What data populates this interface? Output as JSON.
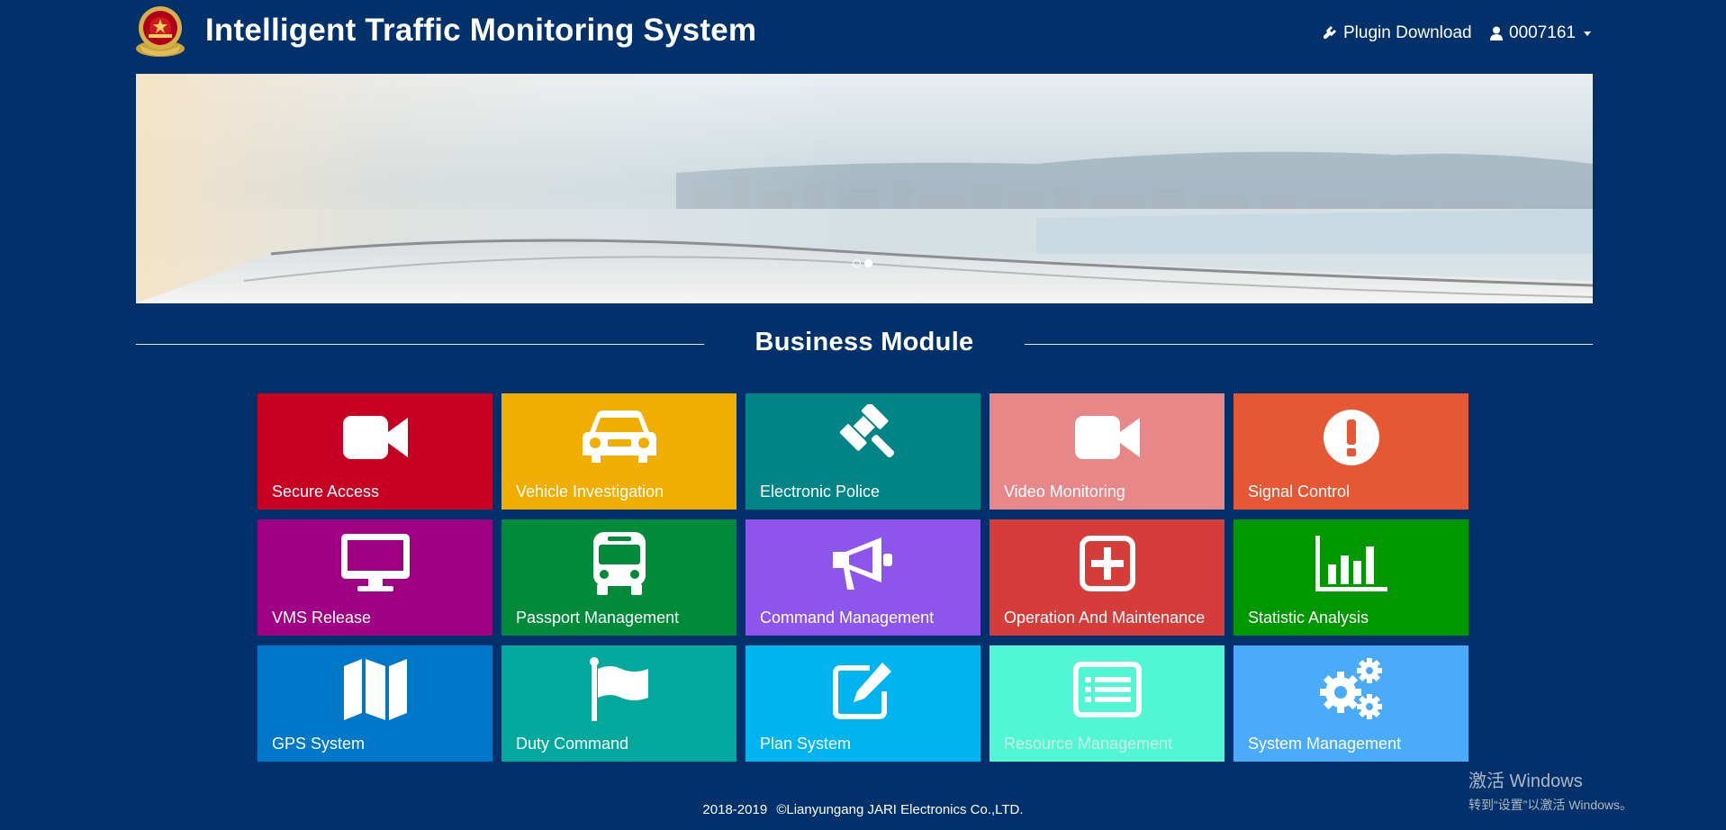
{
  "header": {
    "title": "Intelligent Traffic Monitoring System",
    "plugin_label": "Plugin Download",
    "user_label": "0007161"
  },
  "section": {
    "title": "Business Module"
  },
  "modules": [
    {
      "label": "Secure Access",
      "color": "#c70023",
      "icon": "video-camera-icon"
    },
    {
      "label": "Vehicle Investigation",
      "color": "#f0ae00",
      "icon": "car-icon"
    },
    {
      "label": "Electronic Police",
      "color": "#008485",
      "icon": "gavel-icon"
    },
    {
      "label": "Video Monitoring",
      "color": "#e78788",
      "icon": "video-camera-icon"
    },
    {
      "label": "Signal Control",
      "color": "#e65834",
      "icon": "exclamation-circle-icon"
    },
    {
      "label": "VMS Release",
      "color": "#a00083",
      "icon": "monitor-icon"
    },
    {
      "label": "Passport Management",
      "color": "#008a39",
      "icon": "bus-icon"
    },
    {
      "label": "Command Management",
      "color": "#8d55ec",
      "icon": "bullhorn-icon"
    },
    {
      "label": "Operation And Maintenance",
      "color": "#d43d3a",
      "icon": "plus-square-icon"
    },
    {
      "label": "Statistic Analysis",
      "color": "#019701",
      "icon": "bar-chart-icon"
    },
    {
      "label": "GPS System",
      "color": "#0077c9",
      "icon": "map-icon"
    },
    {
      "label": "Duty Command",
      "color": "#00a99c",
      "icon": "flag-icon"
    },
    {
      "label": "Plan System",
      "color": "#00b4f0",
      "icon": "edit-icon"
    },
    {
      "label": "Resource Management",
      "color": "#51f6d4",
      "icon": "list-alt-icon"
    },
    {
      "label": "System Management",
      "color": "#4aabfb",
      "icon": "gears-icon"
    }
  ],
  "footer": {
    "years": "2018-2019",
    "copyright": "©Lianyungang JARI Electronics Co.,LTD."
  },
  "watermark": {
    "line1": "激活 Windows",
    "line2": "转到“设置”以激活 Windows。"
  }
}
